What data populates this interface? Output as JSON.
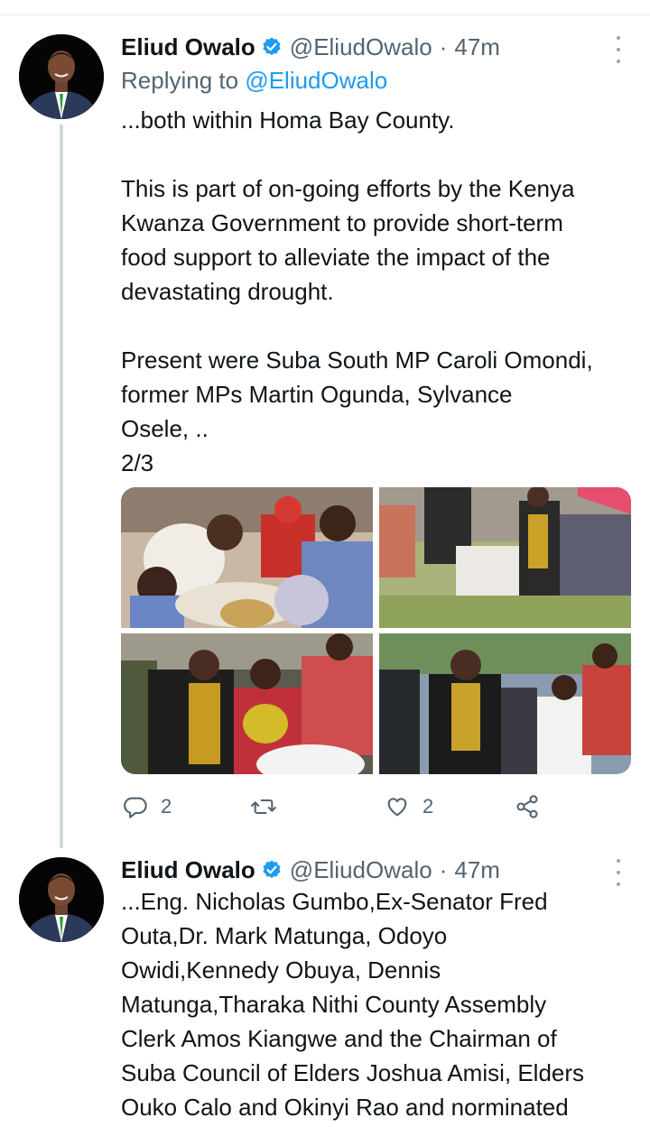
{
  "tweets": [
    {
      "author_name": "Eliud Owalo",
      "handle": "@EliudOwalo",
      "separator": "·",
      "time": "47m",
      "replying_label": "Replying to",
      "replying_handle": "@EliudOwalo",
      "paragraphs": [
        [
          "...both within Homa Bay County."
        ],
        [
          "This is part of on-going efforts by the Kenya",
          "Kwanza Government to provide short-term",
          "food support to alleviate the impact of the",
          "devastating drought."
        ],
        [
          "Present were Suba South MP Caroli Omondi,",
          "former MPs Martin Ogunda, Sylvance",
          "Osele, ..",
          "2/3"
        ]
      ],
      "actions": {
        "reply_count": "2",
        "like_count": "2"
      }
    },
    {
      "author_name": "Eliud Owalo",
      "handle": "@EliudOwalo",
      "separator": "·",
      "time": "47m",
      "lines": [
        "...Eng. Nicholas Gumbo,Ex-Senator Fred",
        "Outa,Dr. Mark Matunga, Odoyo",
        "Owidi,Kennedy Obuya, Dennis",
        "Matunga,Tharaka Nithi County Assembly",
        "Clerk Amos Kiangwe and the Chairman of",
        "Suba Council of Elders Joshua Amisi, Elders",
        "Ouko Calo and Okinyi Rao and norminated"
      ]
    }
  ],
  "colors": {
    "accent": "#1d9bf0",
    "secondary_text": "#536471",
    "verified": "#1d9bf0"
  },
  "icons": [
    "verified-icon",
    "more-icon",
    "reply-icon",
    "retweet-icon",
    "like-icon",
    "share-icon"
  ]
}
